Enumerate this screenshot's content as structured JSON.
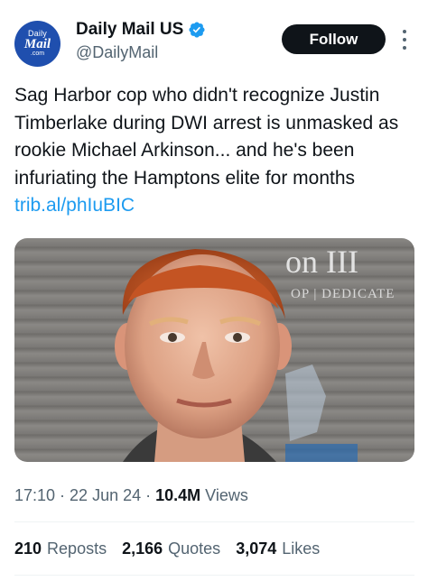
{
  "account": {
    "avatar_line1": "Daily",
    "avatar_line2": "Mail",
    "avatar_line3": ".com",
    "display_name": "Daily Mail US",
    "handle": "@DailyMail",
    "verified_icon": "verified-badge-icon",
    "verified_color": "#1d9bf0"
  },
  "actions": {
    "follow_label": "Follow",
    "more_icon": "more-options-icon"
  },
  "tweet": {
    "text": "Sag Harbor cop who didn't recognize Justin Timberlake during DWI arrest is unmasked as rookie Michael Arkinson... and he's been infuriating the Hamptons elite for months",
    "link": "trib.al/phIuBIC",
    "link_color": "#1d9bf0"
  },
  "media": {
    "backdrop_text_1": "on III",
    "backdrop_text_2": "OP | DEDICATE"
  },
  "meta": {
    "time": "17:10",
    "date": "22 Jun 24",
    "views_count": "10.4M",
    "views_label": "Views"
  },
  "stats": [
    {
      "count": "210",
      "label": "Reposts"
    },
    {
      "count": "2,166",
      "label": "Quotes"
    },
    {
      "count": "3,074",
      "label": "Likes"
    }
  ],
  "colors": {
    "text_primary": "#0f1419",
    "text_secondary": "#536471",
    "follow_bg": "#0f1419",
    "avatar_bg": "#1f4fae"
  }
}
